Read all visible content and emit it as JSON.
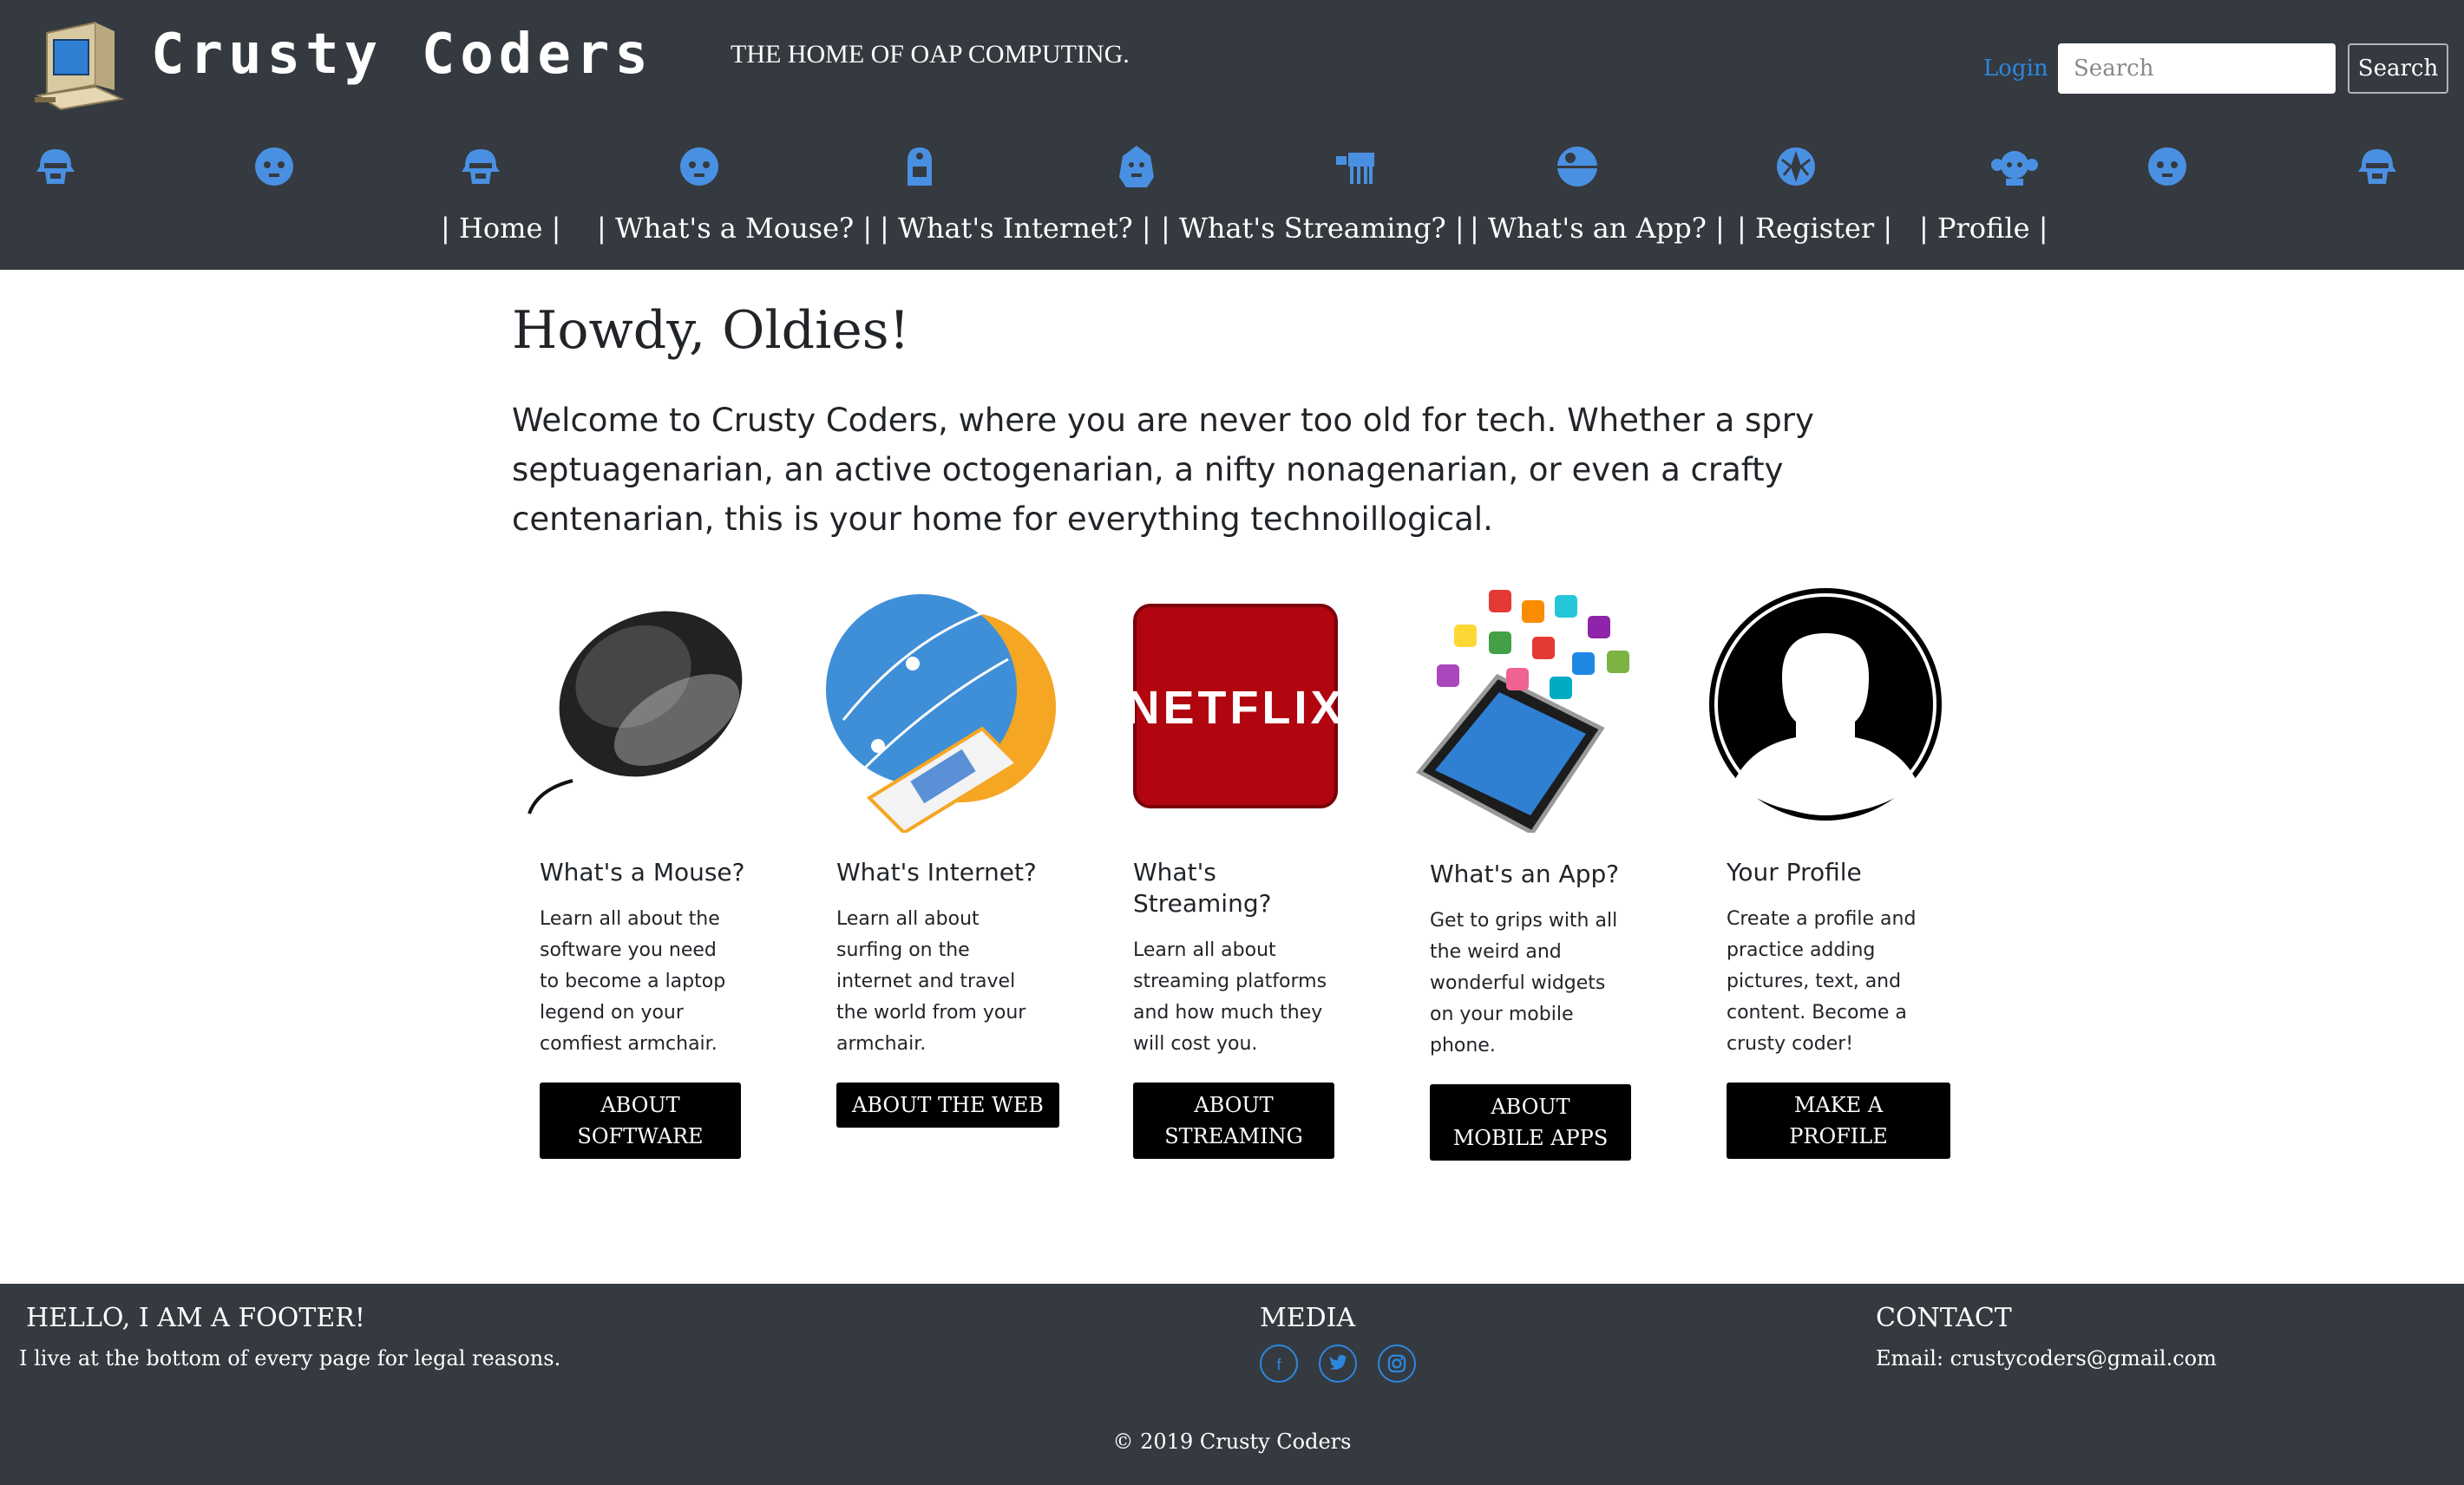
{
  "header": {
    "brand": "Crusty Coders",
    "tagline": "THE HOME OF OAP COMPUTING.",
    "login_label": "Login",
    "search_placeholder": "Search",
    "search_button": "Search"
  },
  "character_icons": [
    "stormtrooper-icon",
    "c3po-icon",
    "stormtrooper-icon",
    "c3po-icon",
    "r2d2-icon",
    "chewbacca-icon",
    "at-at-icon",
    "death-star-icon",
    "rebel-alliance-icon",
    "leia-icon",
    "c3po-icon",
    "stormtrooper-icon"
  ],
  "nav": [
    "| Home |",
    "| What's a Mouse? |",
    "| What's Internet? |",
    "| What's Streaming? |",
    "| What's an App? |",
    "| Register |",
    "| Profile |"
  ],
  "hero": {
    "title": "Howdy, Oldies!",
    "text": "Welcome to Crusty Coders, where you are never too old for tech. Whether a spry septuagenarian, an active octogenarian, a nifty nonagenarian, or even a crafty centenarian, this is your home for everything technoillogical."
  },
  "cards": [
    {
      "image": "computer-mouse-image",
      "title": "What's a Mouse?",
      "text": "Learn all about the software you need to become a laptop legend on your comfiest armchair.",
      "button": "About Software"
    },
    {
      "image": "internet-globe-cable-image",
      "title": "What's Internet?",
      "text": "Learn all about surfing on the internet and travel the world from your armchair.",
      "button": "About the Web"
    },
    {
      "image": "netflix-logo-image",
      "logo_text": "NETFLIX",
      "title": "What's Streaming?",
      "text": "Learn all about streaming platforms and how much they will cost you.",
      "button": "About Streaming"
    },
    {
      "image": "smartphone-apps-image",
      "title": "What's an App?",
      "text": "Get to grips with all the weird and wonderful widgets on your mobile phone.",
      "button": "About Mobile Apps"
    },
    {
      "image": "profile-silhouette-image",
      "title": "Your Profile",
      "text": "Create a profile and practice adding pictures, text, and content. Become a crusty coder!",
      "button": "Make a Profile"
    }
  ],
  "footer": {
    "about_heading": "Hello, I am a footer!",
    "about_text": "I live at the bottom of every page for legal reasons.",
    "media_heading": "Media",
    "social_icons": [
      "facebook-icon",
      "twitter-icon",
      "instagram-icon"
    ],
    "contact_heading": "Contact",
    "contact_text": "Email: crustycoders@gmail.com",
    "copyright": "© 2019 Crusty Coders"
  },
  "colors": {
    "header_bg": "#343a40",
    "accent_blue": "#2e86de",
    "button_bg": "#000000",
    "netflix_red": "#b1060f"
  }
}
